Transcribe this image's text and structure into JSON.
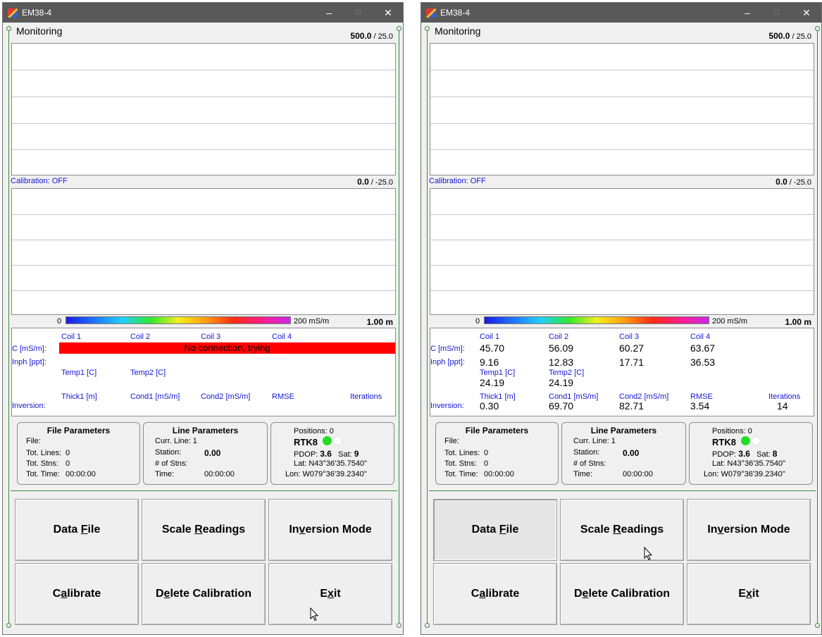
{
  "windows": [
    {
      "title": "EM38-4",
      "heading": "Monitoring",
      "top_scale": {
        "bold": "500.0",
        "rest": " / 25.0"
      },
      "calibration_label": "Calibration: OFF",
      "bottom_scale": {
        "bold": "0.0",
        "rest": " / -25.0"
      },
      "colorbar": {
        "min": "0",
        "max": "200 mS/m",
        "depth": "1.00 m"
      },
      "readings": {
        "coils": [
          "Coil 1",
          "Coil 2",
          "Coil 3",
          "Coil 4"
        ],
        "c_label": "C [mS/m]:",
        "c_values": [],
        "error_text": "No connection, trying",
        "inph_label": "Inph [ppt]:",
        "inph_values": [],
        "temps": [
          "Temp1 [C]",
          "Temp2 [C]"
        ],
        "temp_values": [],
        "inv_headers": [
          "Thick1 [m]",
          "Cond1 [mS/m]",
          "Cond2 [mS/m]",
          "RMSE",
          "Iterations"
        ],
        "inversion_label": "Inversion:",
        "inv_values": []
      },
      "file_params": {
        "title": "File Parameters",
        "file": "File:",
        "tot_lines_label": "Tot. Lines:",
        "tot_lines": "0",
        "tot_stns_label": "Tot. Stns:",
        "tot_stns": "0",
        "tot_time_label": "Tot. Time:",
        "tot_time": "00:00:00"
      },
      "line_params": {
        "title": "Line Parameters",
        "curr_line": "Curr. Line: 1",
        "station_label": "Station:",
        "station": "0.00",
        "num_stns": "# of Stns:",
        "time_label": "Time:",
        "time": "00:00:00"
      },
      "gps": {
        "positions": "Positions: 0",
        "rtk": "RTK8",
        "pdop_label": "PDOP:",
        "pdop": "3.6",
        "sat_label": "Sat:",
        "sat": "9",
        "lat": "Lat: N43°36'35.7540\"",
        "lon": "Lon: W079°36'39.2340\"",
        "led1": "#22dd22",
        "led2": "#ffffff"
      },
      "buttons": {
        "data_file": "Data File",
        "scale_readings": "Scale Readings",
        "inversion_mode": "Inversion Mode",
        "calibrate": "Calibrate",
        "delete_calibration": "Delete Calibration",
        "exit": "Exit"
      }
    },
    {
      "title": "EM38-4",
      "heading": "Monitoring",
      "top_scale": {
        "bold": "500.0",
        "rest": " / 25.0"
      },
      "calibration_label": "Calibration: OFF",
      "bottom_scale": {
        "bold": "0.0",
        "rest": " / -25.0"
      },
      "colorbar": {
        "min": "0",
        "max": "200 mS/m",
        "depth": "1.00 m"
      },
      "readings": {
        "coils": [
          "Coil 1",
          "Coil 2",
          "Coil 3",
          "Coil 4"
        ],
        "c_label": "C [mS/m]:",
        "c_values": [
          "45.70",
          "56.09",
          "60.27",
          "63.67"
        ],
        "error_text": "",
        "inph_label": "Inph [ppt]:",
        "inph_values": [
          "9.16",
          "12.83",
          "17.71",
          "36.53"
        ],
        "temps": [
          "Temp1 [C]",
          "Temp2 [C]"
        ],
        "temp_values": [
          "24.19",
          "24.19"
        ],
        "inv_headers": [
          "Thick1 [m]",
          "Cond1 [mS/m]",
          "Cond2 [mS/m]",
          "RMSE",
          "Iterations"
        ],
        "inversion_label": "Inversion:",
        "inv_values": [
          "0.30",
          "69.70",
          "82.71",
          "3.54",
          "14"
        ]
      },
      "file_params": {
        "title": "File Parameters",
        "file": "File:",
        "tot_lines_label": "Tot. Lines:",
        "tot_lines": "0",
        "tot_stns_label": "Tot. Stns:",
        "tot_stns": "0",
        "tot_time_label": "Tot. Time:",
        "tot_time": "00:00:00"
      },
      "line_params": {
        "title": "Line Parameters",
        "curr_line": "Curr. Line: 1",
        "station_label": "Station:",
        "station": "0.00",
        "num_stns": "# of Stns:",
        "time_label": "Time:",
        "time": "00:00:00"
      },
      "gps": {
        "positions": "Positions: 0",
        "rtk": "RTK8",
        "pdop_label": "PDOP:",
        "pdop": "3.6",
        "sat_label": "Sat:",
        "sat": "8",
        "lat": "Lat: N43°36'35.7540\"",
        "lon": "Lon: W079°36'39.2340\"",
        "led1": "#22dd22",
        "led2": "#ffffff"
      },
      "buttons": {
        "data_file": "Data File",
        "scale_readings": "Scale Readings",
        "inversion_mode": "Inversion Mode",
        "calibrate": "Calibrate",
        "delete_calibration": "Delete Calibration",
        "exit": "Exit"
      }
    }
  ]
}
